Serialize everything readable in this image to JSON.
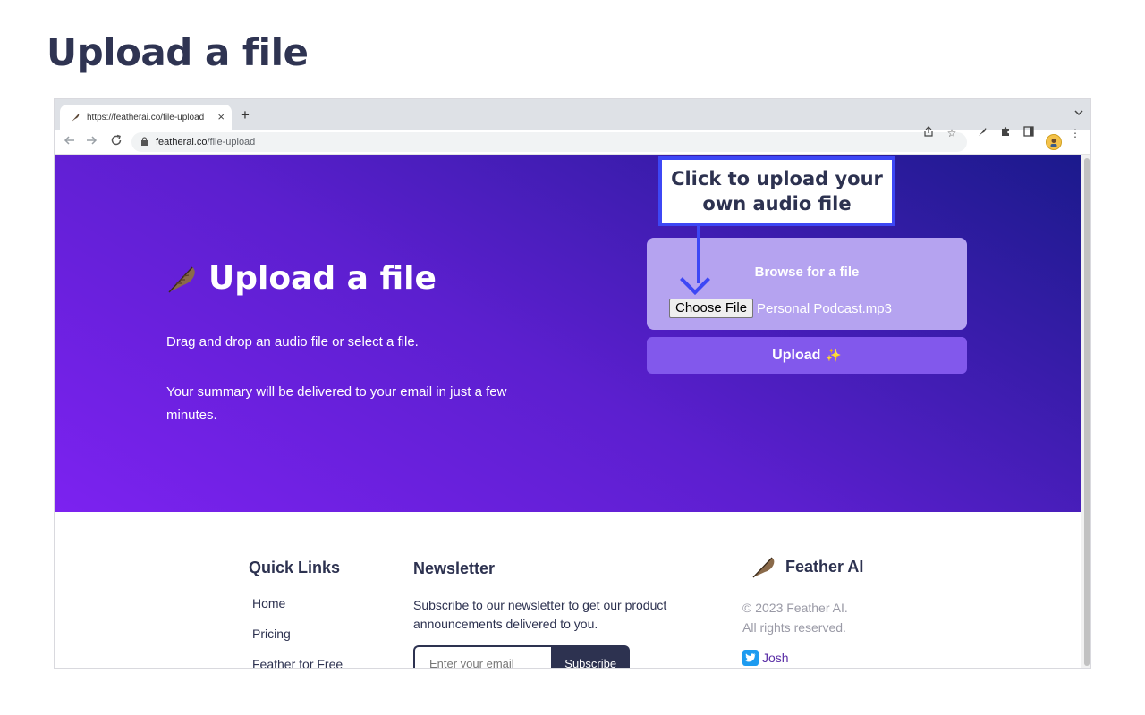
{
  "page": {
    "heading": "Upload a file"
  },
  "browser": {
    "tab": {
      "title": "https://featherai.co/file-upload",
      "close": "×"
    },
    "new_tab": "+",
    "address": {
      "host": "featherai.co",
      "path": "/file-upload"
    },
    "icons": {
      "back": "back-arrow-icon",
      "forward": "forward-arrow-icon",
      "reload": "reload-icon",
      "lock": "lock-icon",
      "share": "share-icon",
      "star": "star-icon",
      "extension": "puzzle-icon"
    }
  },
  "hero": {
    "title": "Upload a file",
    "paragraph1": "Drag and drop an audio file or select a file.",
    "paragraph2": "Your summary will be delivered to your email in just a few minutes.",
    "browse_label": "Browse for a file",
    "choose_file_label": "Choose File",
    "file_name": "Personal Podcast.mp3",
    "upload_label": "Upload",
    "upload_emoji": "✨"
  },
  "callout": {
    "text": "Click to upload your own audio file"
  },
  "footer": {
    "quick_links": {
      "title": "Quick Links",
      "items": [
        "Home",
        "Pricing",
        "Feather for Free"
      ]
    },
    "newsletter": {
      "title": "Newsletter",
      "text": "Subscribe to our newsletter to get our product announcements delivered to you.",
      "placeholder": "Enter your email",
      "button": "Subscribe"
    },
    "brand": {
      "name": "Feather AI",
      "copyright_line1": "© 2023 Feather AI.",
      "copyright_line2": "All rights reserved.",
      "social_name": "Josh"
    }
  },
  "colors": {
    "accent": "#3d47f5",
    "upload_button": "#8258ec",
    "card": "#b5a3f0",
    "dark_text": "#2d3250"
  }
}
